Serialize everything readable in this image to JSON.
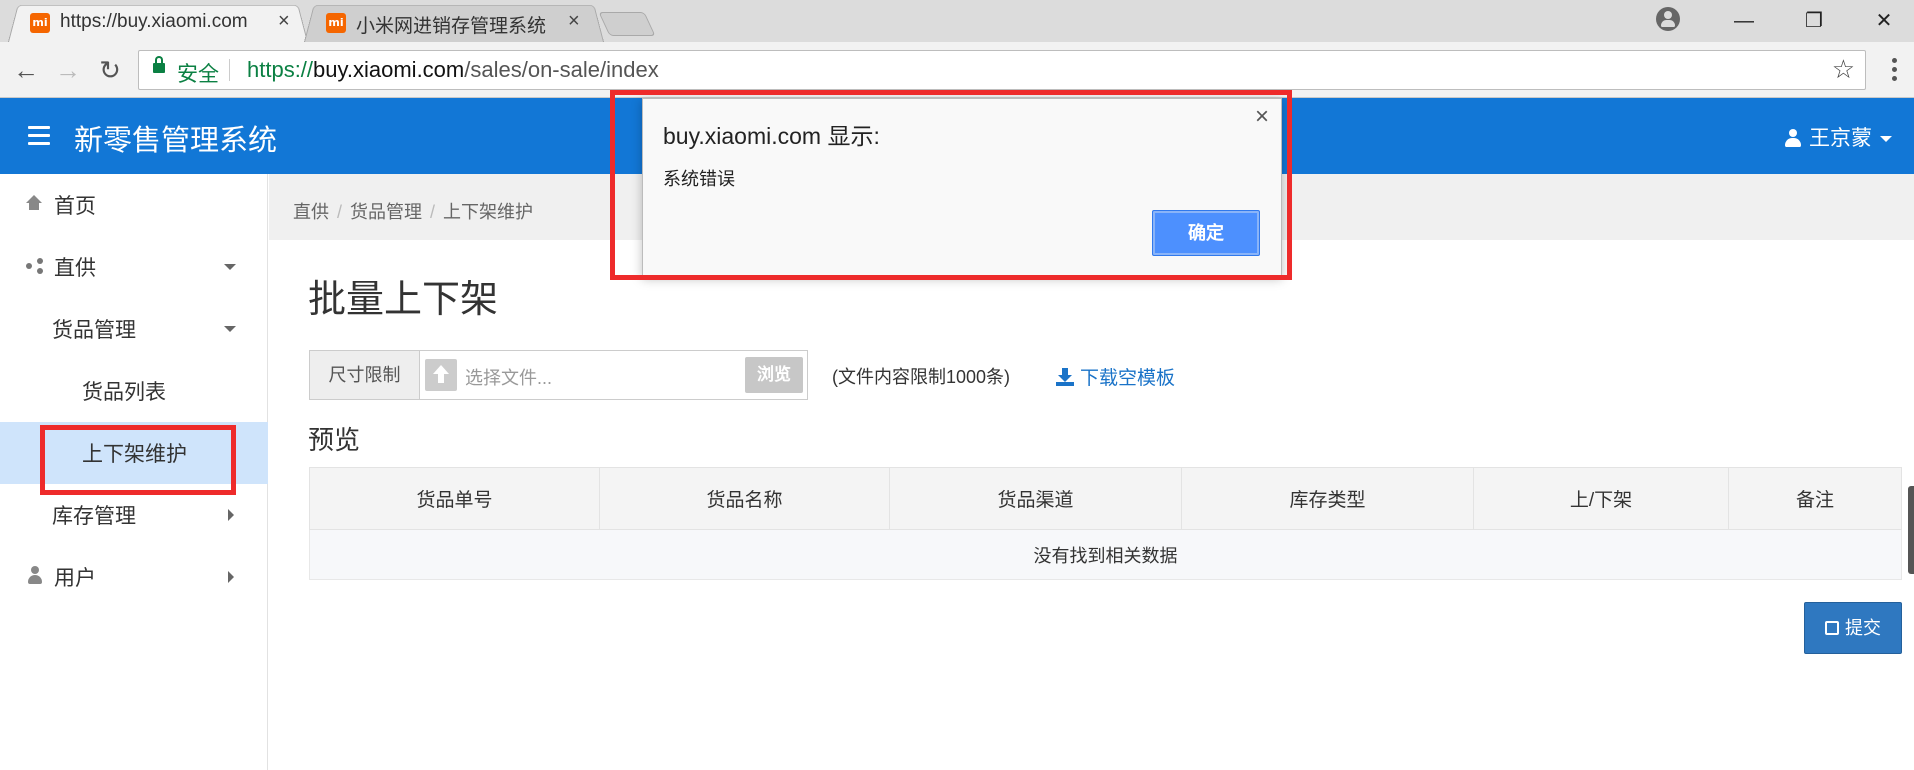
{
  "browser": {
    "tabs": [
      {
        "favicon": "mi",
        "title": "https://buy.xiaomi.com",
        "close": "×"
      },
      {
        "favicon": "mi",
        "title": "小米网进销存管理系统",
        "close": "×"
      }
    ],
    "window_controls": {
      "minimize": "—",
      "maximize": "❐",
      "close": "✕"
    },
    "nav": {
      "back": "←",
      "forward": "→",
      "reload": "↻"
    },
    "security_label": "安全",
    "url": {
      "scheme": "https://",
      "host": "buy.xiaomi.com",
      "path": "/sales/on-sale/index"
    },
    "bookmark_icon": "☆"
  },
  "app": {
    "title": "新零售管理系统",
    "user": "王京蒙"
  },
  "sidebar": {
    "items": [
      {
        "label": "首页",
        "icon": "home-icon"
      },
      {
        "label": "直供",
        "icon": "share-icon"
      },
      {
        "label": "货品管理"
      },
      {
        "label": "货品列表"
      },
      {
        "label": "上下架维护",
        "active": true
      },
      {
        "label": "库存管理"
      },
      {
        "label": "用户",
        "icon": "user-icon"
      }
    ]
  },
  "breadcrumb": [
    "直供",
    "货品管理",
    "上下架维护"
  ],
  "breadcrumb_sep": "/",
  "page": {
    "title": "批量上下架",
    "upload": {
      "addon": "尺寸限制",
      "placeholder": "选择文件...",
      "browse": "浏览"
    },
    "limit_note": "(文件内容限制1000条)",
    "download_link": "下载空模板",
    "preview_title": "预览",
    "table": {
      "columns": [
        "货品单号",
        "货品名称",
        "货品渠道",
        "库存类型",
        "上/下架",
        "备注"
      ],
      "empty_text": "没有找到相关数据"
    },
    "submit": "提交"
  },
  "dialog": {
    "title": "buy.xiaomi.com 显示:",
    "message": "系统错误",
    "ok": "确定",
    "close": "×"
  },
  "colors": {
    "header_blue": "#1277d6",
    "active_bg": "#cfe4fb",
    "link": "#1a73c8",
    "submit": "#2f78c0",
    "highlight": "#ee2b2b"
  }
}
